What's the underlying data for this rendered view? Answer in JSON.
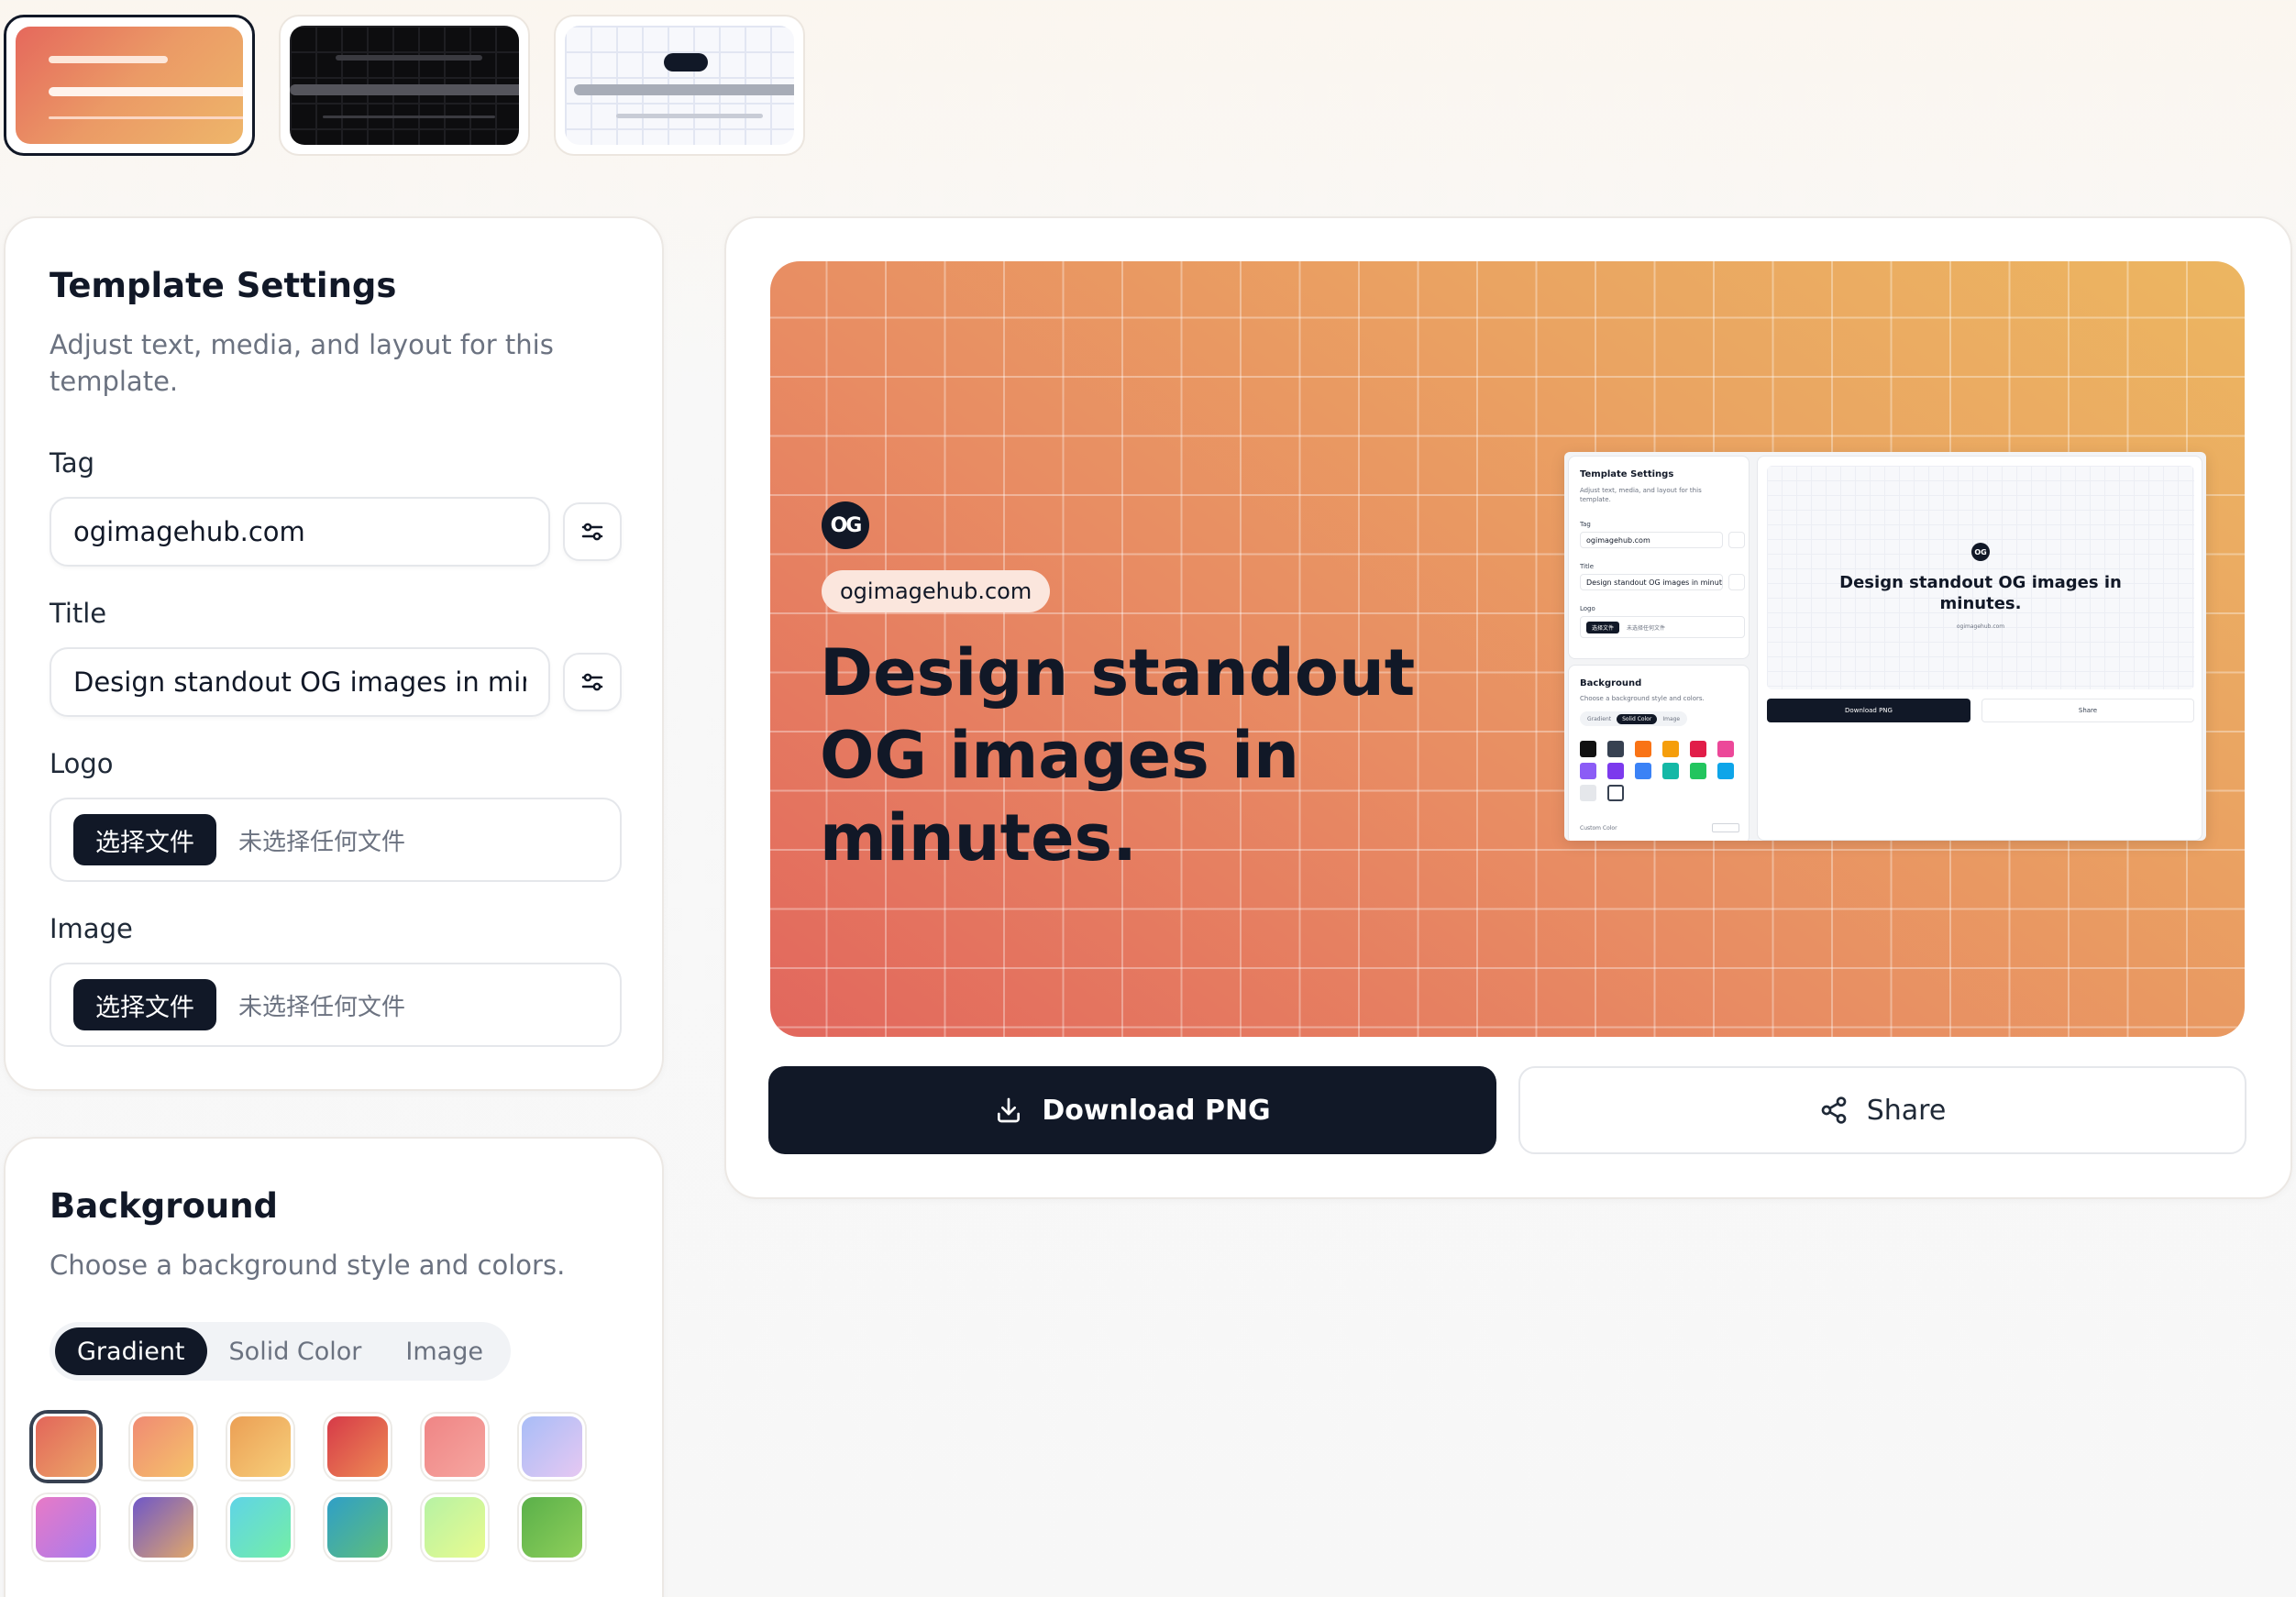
{
  "templates": [
    {
      "name": "gradient",
      "selected": true
    },
    {
      "name": "dark-grid",
      "selected": false
    },
    {
      "name": "light-grid",
      "selected": false
    }
  ],
  "settings": {
    "title": "Template Settings",
    "description": "Adjust text, media, and layout for this template.",
    "tag_label": "Tag",
    "tag_value": "ogimagehub.com",
    "title_label": "Title",
    "title_value": "Design standout OG images in minutes.",
    "logo_label": "Logo",
    "image_label": "Image",
    "file_button": "选择文件",
    "file_status": "未选择任何文件"
  },
  "background": {
    "title": "Background",
    "description": "Choose a background style and colors.",
    "tabs": [
      "Gradient",
      "Solid Color",
      "Image"
    ],
    "active_tab": "Gradient",
    "swatches": [
      [
        "#e2665a",
        "#eca768"
      ],
      [
        "#f08a73",
        "#f5c36b"
      ],
      [
        "#eb9f55",
        "#f7cf7a"
      ],
      [
        "#d63a48",
        "#ee8c55"
      ],
      [
        "#ef8585",
        "#f6a6a0"
      ],
      [
        "#a8bdf7",
        "#e6c8f2"
      ],
      [
        "#e87ac6",
        "#a87bee"
      ],
      [
        "#6f57c8",
        "#e0a76a"
      ],
      [
        "#5fd4e6",
        "#74eea6"
      ],
      [
        "#2f9fc7",
        "#5fbe7a"
      ],
      [
        "#b6f2a4",
        "#e9fb8f"
      ],
      [
        "#5ab04a",
        "#8ecf5a"
      ]
    ]
  },
  "preview": {
    "logo_text": "OG",
    "tag": "ogimagehub.com",
    "title": "Design standout OG images in minutes."
  },
  "mini": {
    "settings_title": "Template Settings",
    "settings_desc": "Adjust text, media, and layout for this template.",
    "tag_label": "Tag",
    "tag_value": "ogimagehub.com",
    "title_label": "Title",
    "title_value": "Design standout OG images in minut",
    "logo_label": "Logo",
    "file_button": "选择文件",
    "file_status": "未选择任何文件",
    "bg_title": "Background",
    "bg_desc": "Choose a background style and colors.",
    "tabs": [
      "Gradient",
      "Solid Color",
      "Image"
    ],
    "custom_color": "Custom Color",
    "preview_title": "Design standout OG images in minutes.",
    "preview_tag": "ogimagehub.com",
    "download": "Download PNG",
    "share": "Share",
    "colors": [
      "#111111",
      "#374151",
      "#f97316",
      "#f59e0b",
      "#e11d48",
      "#ec4899",
      "#8b5cf6",
      "#7c3aed",
      "#3b82f6",
      "#14b8a6",
      "#22c55e",
      "#0ea5e9",
      "#e5e7eb",
      "#ffffff"
    ]
  },
  "actions": {
    "download": "Download PNG",
    "share": "Share"
  }
}
